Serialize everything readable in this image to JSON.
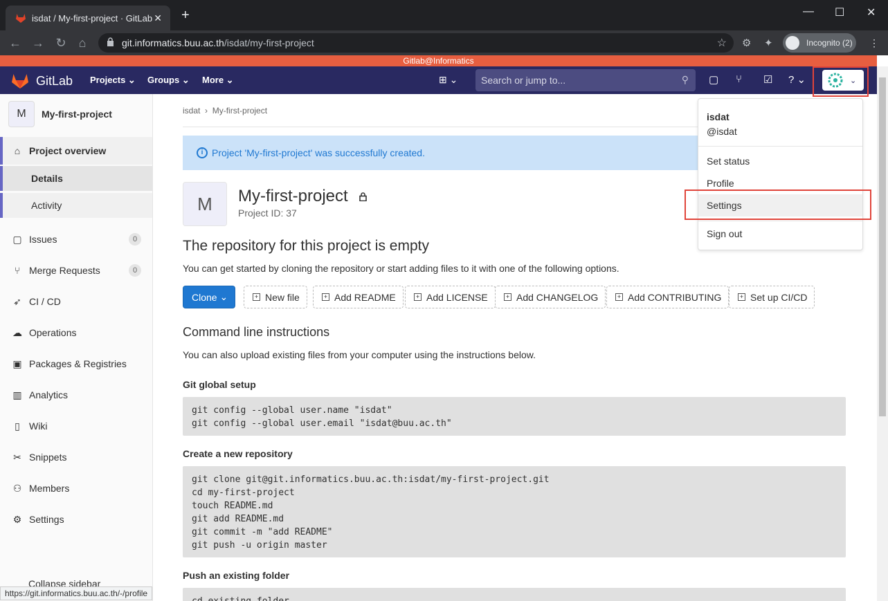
{
  "browser": {
    "tab_title": "isdat / My-first-project · GitLab",
    "url_host": "git.informatics.buu.ac.th",
    "url_path": "/isdat/my-first-project",
    "incognito_label": "Incognito (2)",
    "status_url": "https://git.informatics.buu.ac.th/-/profile"
  },
  "banner": "Gitlab@Informatics",
  "topnav": {
    "brand": "GitLab",
    "projects": "Projects",
    "groups": "Groups",
    "more": "More",
    "search_placeholder": "Search or jump to..."
  },
  "sidebar": {
    "project_initial": "M",
    "project_name": "My-first-project",
    "overview": "Project overview",
    "details": "Details",
    "activity": "Activity",
    "items": [
      {
        "label": "Issues",
        "count": "0",
        "icon": "issues-icon"
      },
      {
        "label": "Merge Requests",
        "count": "0",
        "icon": "merge-request-icon"
      },
      {
        "label": "CI / CD",
        "icon": "rocket-icon"
      },
      {
        "label": "Operations",
        "icon": "cloud-icon"
      },
      {
        "label": "Packages & Registries",
        "icon": "package-icon"
      },
      {
        "label": "Analytics",
        "icon": "chart-icon"
      },
      {
        "label": "Wiki",
        "icon": "book-icon"
      },
      {
        "label": "Snippets",
        "icon": "scissors-icon"
      },
      {
        "label": "Members",
        "icon": "users-icon"
      },
      {
        "label": "Settings",
        "icon": "gear-icon"
      }
    ],
    "collapse": "Collapse sidebar"
  },
  "main": {
    "breadcrumb_1": "isdat",
    "breadcrumb_2": "My-first-project",
    "flash": "Project 'My-first-project' was successfully created.",
    "project_initial": "M",
    "title": "My-first-project",
    "project_id": "Project ID: 37",
    "empty_heading": "The repository for this project is empty",
    "empty_text": "You can get started by cloning the repository or start adding files to it with one of the following options.",
    "buttons": {
      "clone": "Clone",
      "new_file": "New file",
      "readme": "Add README",
      "license": "Add LICENSE",
      "changelog": "Add CHANGELOG",
      "contributing": "Add CONTRIBUTING",
      "cicd": "Set up CI/CD"
    },
    "cli_heading": "Command line instructions",
    "cli_text": "You can also upload existing files from your computer using the instructions below.",
    "global_setup_heading": "Git global setup",
    "global_setup_code": "git config --global user.name \"isdat\"\ngit config --global user.email \"isdat@buu.ac.th\"",
    "new_repo_heading": "Create a new repository",
    "new_repo_code": "git clone git@git.informatics.buu.ac.th:isdat/my-first-project.git\ncd my-first-project\ntouch README.md\ngit add README.md\ngit commit -m \"add README\"\ngit push -u origin master",
    "existing_heading": "Push an existing folder",
    "existing_code": "cd existing_folder"
  },
  "user_menu": {
    "name": "isdat",
    "handle": "@isdat",
    "set_status": "Set status",
    "profile": "Profile",
    "settings": "Settings",
    "sign_out": "Sign out"
  },
  "colors": {
    "nav_bg": "#292961",
    "banner_bg": "#e75e40",
    "primary": "#1f78d1",
    "highlight_box": "#e0443a"
  }
}
